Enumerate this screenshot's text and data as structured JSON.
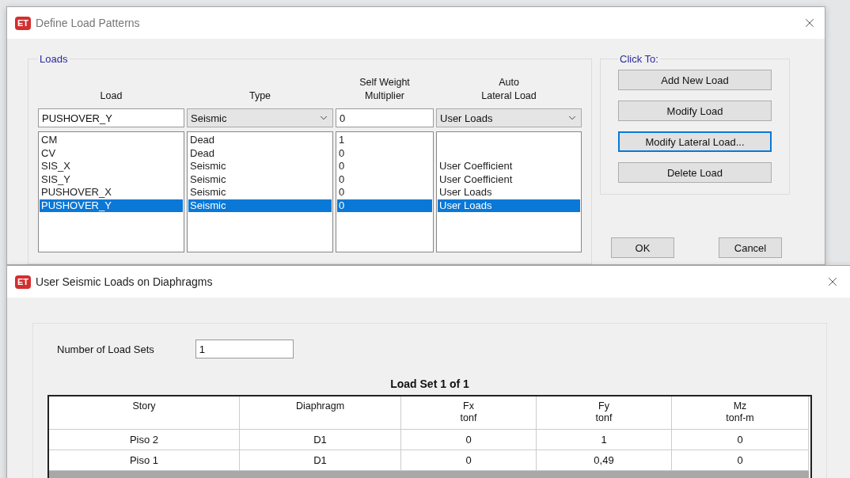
{
  "define_dialog": {
    "app_badge": "ET",
    "title": "Define Load Patterns",
    "loads_group": {
      "legend": "Loads",
      "headers": {
        "load": "Load",
        "type": "Type",
        "multiplier": [
          "Self Weight",
          "Multiplier"
        ],
        "auto_lateral": [
          "Auto",
          "Lateral Load"
        ]
      },
      "edit_row": {
        "load": "PUSHOVER_Y",
        "type": "Seismic",
        "multiplier": "0",
        "auto_lateral": "User Loads"
      },
      "rows": [
        {
          "name": "CM",
          "type": "Dead",
          "multiplier": "1",
          "selected": false
        },
        {
          "name": "CV",
          "type": "Dead",
          "multiplier": "0",
          "selected": false
        },
        {
          "name": "SIS_X",
          "type": "Seismic",
          "multiplier": "0",
          "auto_lateral": "User Coefficient",
          "selected": false
        },
        {
          "name": "SIS_Y",
          "type": "Seismic",
          "multiplier": "0",
          "auto_lateral": "User Coefficient",
          "selected": false
        },
        {
          "name": "PUSHOVER_X",
          "type": "Seismic",
          "multiplier": "0",
          "auto_lateral": "User Loads",
          "selected": false
        },
        {
          "name": "PUSHOVER_Y",
          "type": "Seismic",
          "multiplier": "0",
          "auto_lateral": "User Loads",
          "selected": true
        }
      ]
    },
    "click_group": {
      "legend": "Click To:",
      "buttons": [
        {
          "label": "Add New Load",
          "focused": false
        },
        {
          "label": "Modify Load",
          "focused": false
        },
        {
          "label": "Modify Lateral Load...",
          "focused": true
        },
        {
          "label": "Delete Load",
          "focused": false
        }
      ]
    },
    "footer_buttons": [
      "OK",
      "Cancel"
    ]
  },
  "seismic_dialog": {
    "app_badge": "ET",
    "title": "User Seismic Loads on Diaphragms",
    "load_sets_label": "Number of Load Sets",
    "load_sets_value": "1",
    "table_title": "Load Set 1 of 1",
    "columns": [
      {
        "name": "Story"
      },
      {
        "name": "Diaphragm"
      },
      {
        "name": "Fx",
        "unit": "tonf"
      },
      {
        "name": "Fy",
        "unit": "tonf"
      },
      {
        "name": "Mz",
        "unit": "tonf-m"
      }
    ],
    "rows": [
      [
        "Piso 2",
        "D1",
        "0",
        "1",
        "0"
      ],
      [
        "Piso 1",
        "D1",
        "0",
        "0,49",
        "0"
      ]
    ]
  }
}
